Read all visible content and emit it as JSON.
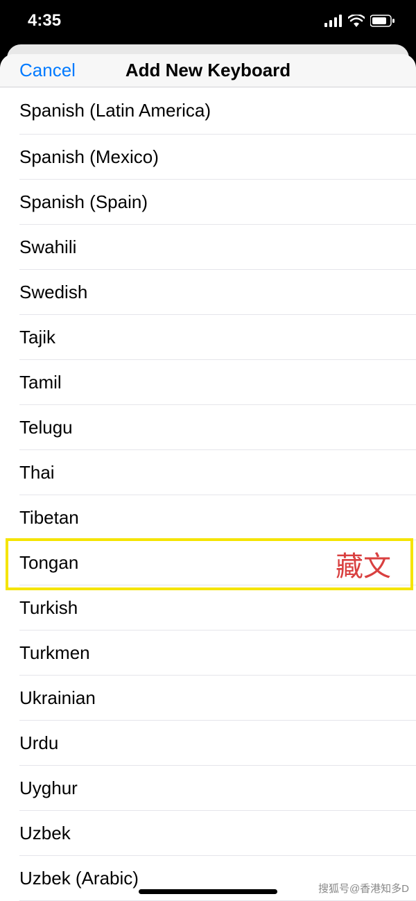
{
  "status": {
    "time": "4:35"
  },
  "nav": {
    "cancel": "Cancel",
    "title": "Add New Keyboard"
  },
  "keyboards": [
    "Spanish (Latin America)",
    "Spanish (Mexico)",
    "Spanish (Spain)",
    "Swahili",
    "Swedish",
    "Tajik",
    "Tamil",
    "Telugu",
    "Thai",
    "Tibetan",
    "Tongan",
    "Turkish",
    "Turkmen",
    "Ukrainian",
    "Urdu",
    "Uyghur",
    "Uzbek",
    "Uzbek (Arabic)"
  ],
  "annotation": "藏文",
  "watermark": "搜狐号@香港知多D"
}
